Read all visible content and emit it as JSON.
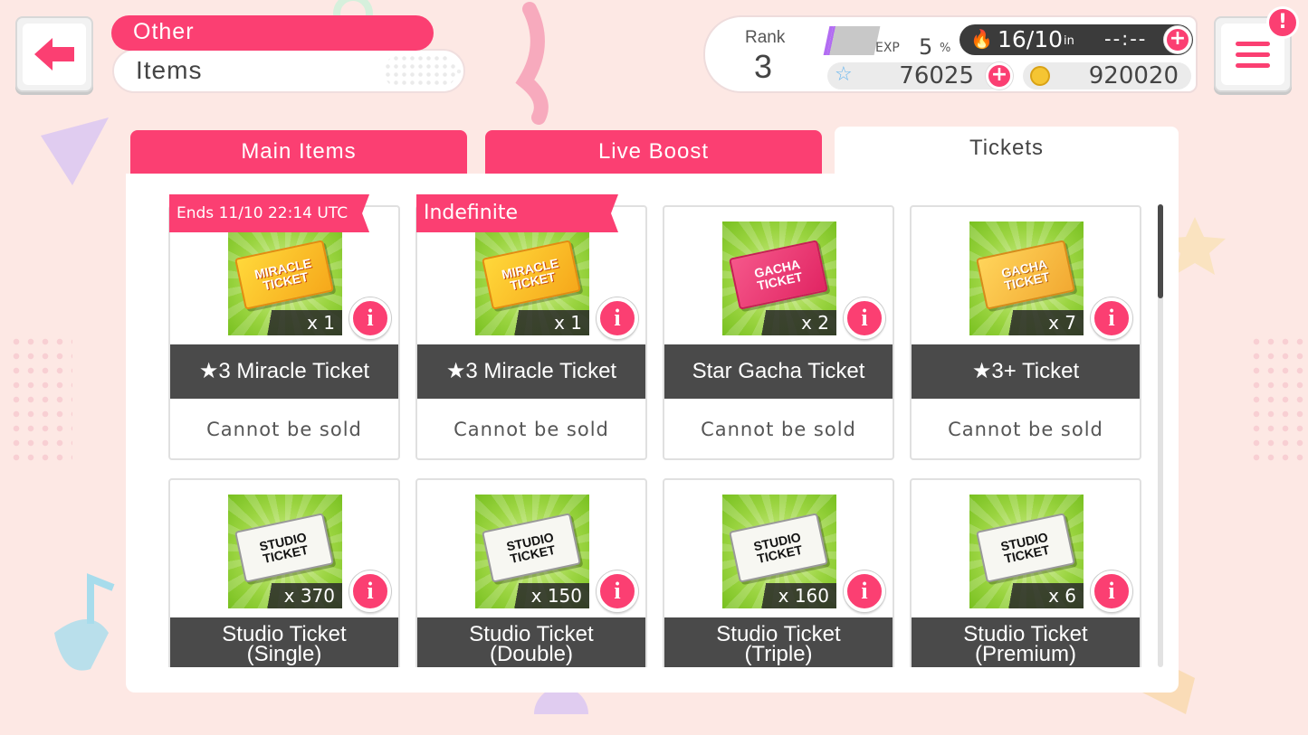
{
  "header": {
    "category": "Other",
    "title": "Items"
  },
  "status": {
    "rank_label": "Rank",
    "rank_value": "3",
    "exp_label": "EXP",
    "exp_value": "5",
    "exp_unit": "%",
    "exp_progress_pct": 5,
    "stamina_value": "16/10",
    "stamina_in": "in",
    "stamina_timer": "--:--",
    "star_gems": "76025",
    "coins": "920020"
  },
  "menu": {
    "alert": "!"
  },
  "tabs": [
    {
      "label": "Main Items",
      "active": false
    },
    {
      "label": "Live Boost",
      "active": false
    },
    {
      "label": "Tickets",
      "active": true
    }
  ],
  "items": [
    {
      "name": "★3 Miracle Ticket",
      "qty": "x 1",
      "sell": "Cannot be sold",
      "ribbon": "Ends 11/10 22:14 UTC",
      "art": "MIRACLE TICKET"
    },
    {
      "name": "★3 Miracle Ticket",
      "qty": "x 1",
      "sell": "Cannot be sold",
      "ribbon": "Indefinite",
      "art": "MIRACLE TICKET"
    },
    {
      "name": "Star Gacha Ticket",
      "qty": "x 2",
      "sell": "Cannot be sold",
      "art": "GACHA TICKET"
    },
    {
      "name": "★3+ Ticket",
      "qty": "x 7",
      "sell": "Cannot be sold",
      "art": "GACHA TICKET"
    },
    {
      "name_line1": "Studio Ticket",
      "name_line2": "(Single)",
      "qty": "x 370",
      "art": "STUDIO TICKET"
    },
    {
      "name_line1": "Studio Ticket",
      "name_line2": "(Double)",
      "qty": "x 150",
      "art": "STUDIO TICKET"
    },
    {
      "name_line1": "Studio Ticket",
      "name_line2": "(Triple)",
      "qty": "x 160",
      "art": "STUDIO TICKET"
    },
    {
      "name_line1": "Studio Ticket",
      "name_line2": "(Premium)",
      "qty": "x 6",
      "art": "STUDIO TICKET"
    }
  ],
  "info_glyph": "i",
  "colors": {
    "accent": "#fb3f72",
    "background": "#fde8e4",
    "dark_label": "#4a4a4a"
  }
}
